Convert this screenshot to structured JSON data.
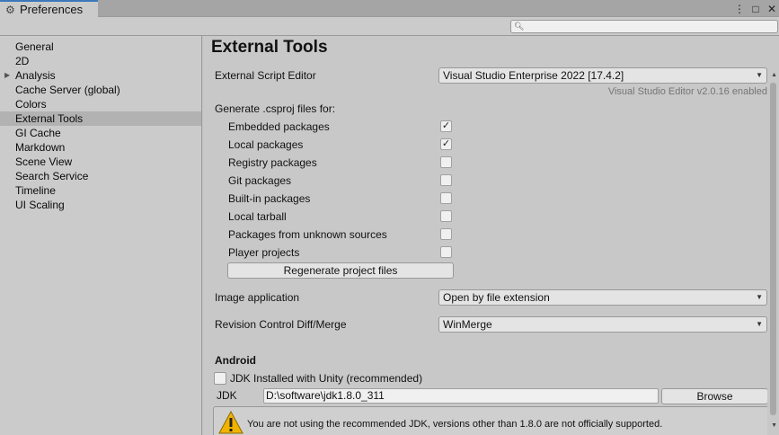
{
  "window": {
    "tab_title": "Preferences",
    "controls": [
      "⋮",
      "□",
      "✕"
    ]
  },
  "search": {
    "value": "",
    "placeholder": ""
  },
  "sidebar": {
    "items": [
      {
        "label": "General",
        "selected": false,
        "expandable": false
      },
      {
        "label": "2D",
        "selected": false,
        "expandable": false
      },
      {
        "label": "Analysis",
        "selected": false,
        "expandable": true
      },
      {
        "label": "Cache Server (global)",
        "selected": false,
        "expandable": false
      },
      {
        "label": "Colors",
        "selected": false,
        "expandable": false
      },
      {
        "label": "External Tools",
        "selected": true,
        "expandable": false
      },
      {
        "label": "GI Cache",
        "selected": false,
        "expandable": false
      },
      {
        "label": "Markdown",
        "selected": false,
        "expandable": false
      },
      {
        "label": "Scene View",
        "selected": false,
        "expandable": false
      },
      {
        "label": "Search Service",
        "selected": false,
        "expandable": false
      },
      {
        "label": "Timeline",
        "selected": false,
        "expandable": false
      },
      {
        "label": "UI Scaling",
        "selected": false,
        "expandable": false
      }
    ]
  },
  "main": {
    "title": "External Tools",
    "script_editor": {
      "label": "External Script Editor",
      "value": "Visual Studio Enterprise 2022 [17.4.2]",
      "note": "Visual Studio Editor v2.0.16 enabled"
    },
    "csproj": {
      "label": "Generate .csproj files for:",
      "options": [
        {
          "label": "Embedded packages",
          "checked": true
        },
        {
          "label": "Local packages",
          "checked": true
        },
        {
          "label": "Registry packages",
          "checked": false
        },
        {
          "label": "Git packages",
          "checked": false
        },
        {
          "label": "Built-in packages",
          "checked": false
        },
        {
          "label": "Local tarball",
          "checked": false
        },
        {
          "label": "Packages from unknown sources",
          "checked": false
        },
        {
          "label": "Player projects",
          "checked": false
        }
      ],
      "regenerate_label": "Regenerate project files"
    },
    "image_app": {
      "label": "Image application",
      "value": "Open by file extension"
    },
    "diff_merge": {
      "label": "Revision Control Diff/Merge",
      "value": "WinMerge"
    },
    "android": {
      "section_title": "Android",
      "jdk_with_unity_label": "JDK Installed with Unity (recommended)",
      "jdk_with_unity_checked": false,
      "jdk_label": "JDK",
      "jdk_path": "D:\\software\\jdk1.8.0_311",
      "browse_label": "Browse",
      "warning": "You are not using the recommended JDK, versions other than 1.8.0 are not officially supported."
    }
  },
  "colors": {
    "tab_accent": "#3a79bb",
    "selected_item": "#b2b2b2",
    "warning_yellow": "#f1b300"
  },
  "icons": {
    "tab": "gear-icon",
    "search": "search-icon",
    "dropdown": "caret-down-icon",
    "warning": "warning-icon"
  }
}
